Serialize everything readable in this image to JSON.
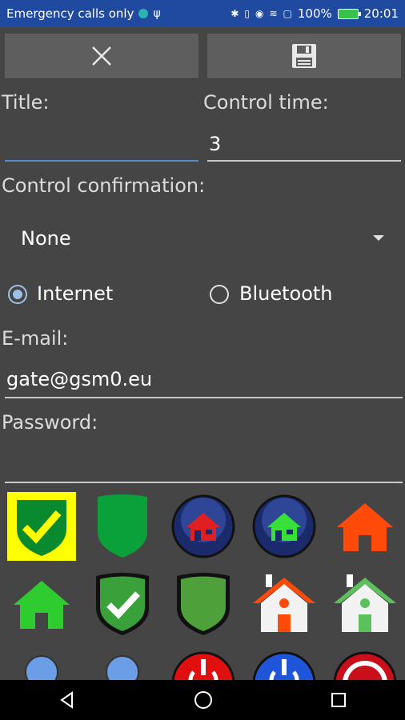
{
  "status_bar": {
    "carrier": "Emergency calls only",
    "battery": "100%",
    "time": "20:01"
  },
  "toolbar": {
    "close_icon": "close-icon",
    "save_icon": "save-icon"
  },
  "form": {
    "title_label": "Title:",
    "title_value": "",
    "control_time_label": "Control time:",
    "control_time_value": "3",
    "confirmation_label": "Control confirmation:",
    "confirmation_selected": "None",
    "connection": {
      "internet_label": "Internet",
      "bluetooth_label": "Bluetooth",
      "selected": "Internet"
    },
    "email_label": "E-mail:",
    "email_value": "gate@gsm0.eu",
    "password_label": "Password:",
    "password_value": ""
  },
  "icons": [
    "shield-check-yellow-icon",
    "shield-green-icon",
    "home-blue-red-icon",
    "home-blue-green-icon",
    "home-orange-icon",
    "home-green-icon",
    "shield-check-dark-icon",
    "shield-dark-green-icon",
    "house-red-roof-icon",
    "house-green-roof-icon",
    "blue-circle-icon",
    "blue-circle-icon",
    "power-red-icon",
    "power-blue-icon",
    "power-red-ring-icon"
  ],
  "colors": {
    "background": "#454545",
    "status_bar": "#1f4aa0",
    "accent": "#9fc0e6",
    "selected_icon_bg": "#ffff00"
  }
}
